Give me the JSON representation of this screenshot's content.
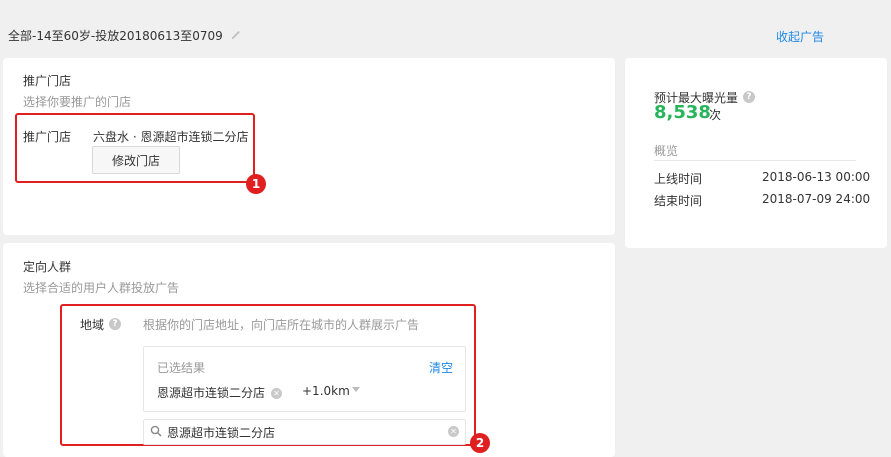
{
  "header": {
    "title": "全部-14至60岁-投放20180613至0709",
    "collapse_label": "收起广告"
  },
  "store_card": {
    "title": "推广门店",
    "subtitle": "选择你要推广的门店",
    "field_label": "推广门店",
    "store_name": "六盘水 · 恩源超市连锁二分店",
    "modify_button": "修改门店",
    "badge": "1"
  },
  "audience_card": {
    "title": "定向人群",
    "subtitle": "选择合适的用户人群投放广告",
    "region_label": "地域",
    "region_desc": "根据你的门店地址，向门店所在城市的人群展示广告",
    "selected_title": "已选结果",
    "clear_label": "清空",
    "selected_store": "恩源超市连锁二分店",
    "radius": "+1.0km",
    "search_value": "恩源超市连锁二分店",
    "badge": "2"
  },
  "summary": {
    "exposure_label": "预计最大曝光量",
    "exposure_value": "8,538",
    "exposure_unit": "次",
    "overview_label": "概览",
    "online_label": "上线时间",
    "online_value": "2018-06-13 00:00",
    "end_label": "结束时间",
    "end_value": "2018-07-09 24:00"
  },
  "icons": {
    "edit": "pencil-icon",
    "help": "question-icon",
    "remove": "close-circle-icon",
    "dropdown": "caret-down-icon",
    "search": "search-icon",
    "clear_input": "close-circle-icon"
  },
  "colors": {
    "accent": "#1e88e5",
    "highlight": "#e02020",
    "success": "#27b45a"
  }
}
